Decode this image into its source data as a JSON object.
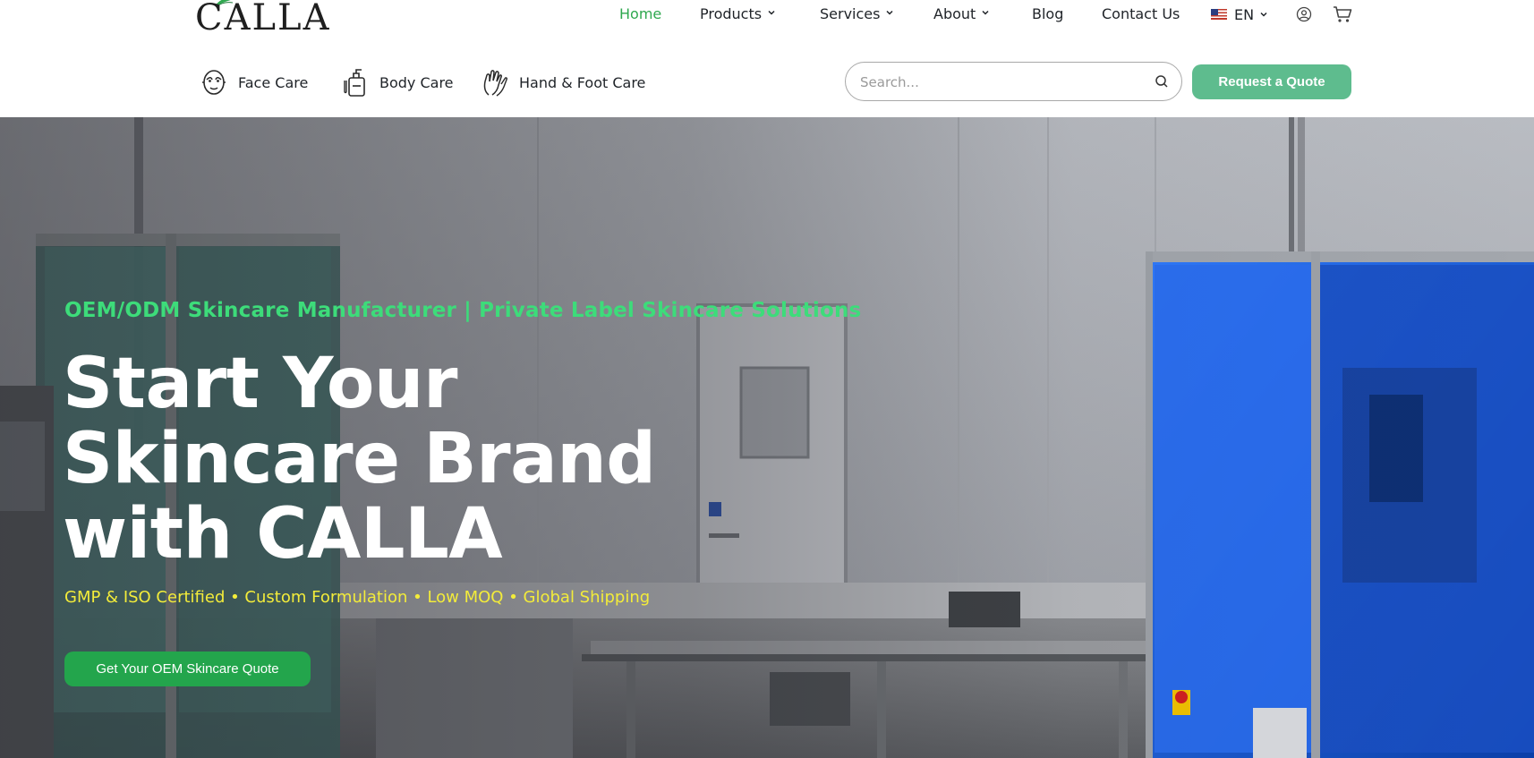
{
  "brand": {
    "logo_text": "CALLA"
  },
  "nav": {
    "items": [
      {
        "label": "Home",
        "active": true,
        "has_dropdown": false
      },
      {
        "label": "Products",
        "active": false,
        "has_dropdown": true
      },
      {
        "label": "Services",
        "active": false,
        "has_dropdown": true
      },
      {
        "label": "About",
        "active": false,
        "has_dropdown": true
      },
      {
        "label": "Blog",
        "active": false,
        "has_dropdown": false
      },
      {
        "label": "Contact Us",
        "active": false,
        "has_dropdown": false
      }
    ],
    "language": {
      "label": "EN",
      "flag": "us-flag-icon"
    },
    "icons": [
      "user-icon",
      "cart-icon"
    ]
  },
  "categories": [
    {
      "label": "Face Care",
      "icon": "face-mask-icon"
    },
    {
      "label": "Body Care",
      "icon": "lotion-bottle-icon"
    },
    {
      "label": "Hand & Foot Care",
      "icon": "hands-icon"
    }
  ],
  "search": {
    "placeholder": "Search...",
    "value": ""
  },
  "header_cta": {
    "label": "Request a Quote"
  },
  "hero": {
    "eyebrow": "OEM/ODM Skincare Manufacturer | Private Label Skincare Solutions",
    "headline_lines": [
      "Start Your",
      "Skincare Brand",
      "with CALLA"
    ],
    "subline": "GMP & ISO Certified • Custom Formulation • Low MOQ • Global Shipping",
    "cta_label": "Get Your OEM Skincare Quote"
  },
  "colors": {
    "brand_green": "#2fa84f",
    "quote_button": "#5ebc8e",
    "hero_cta": "#23a54c",
    "eyebrow_green": "#3ddc7a",
    "subline_yellow": "#f3ec3a",
    "machine_blue": "#1f5fd6"
  }
}
